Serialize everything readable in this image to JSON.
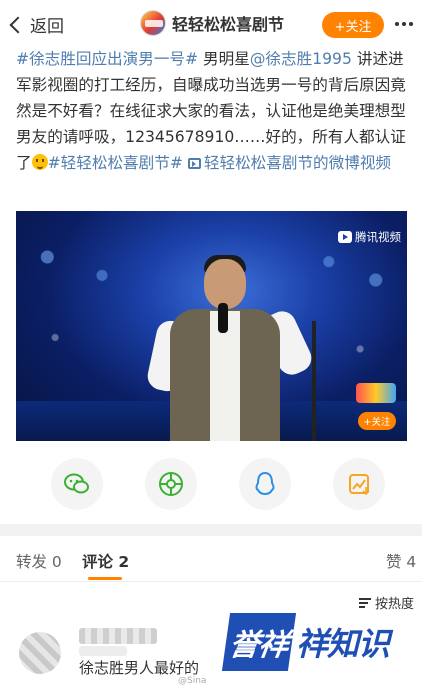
{
  "topbar": {
    "back_label": "返回",
    "account_name": "轻轻松松喜剧节",
    "follow_label": "+关注"
  },
  "post": {
    "seg1": "#徐志胜回应出演男一号#",
    "seg2": " 男明星",
    "seg3": "@徐志胜1995",
    "seg4": " 讲述进军影视圈的打工经历，自曝成功当选男一号的背后原因竟然是不好看？在线征求大家的看法，认证他是绝美理想型男友的请呼吸，12345678910……好的，所有人都认证了",
    "seg5": "#轻轻松松喜剧节#",
    "seg6": "轻轻松松喜剧节的微博视频"
  },
  "video": {
    "watermark": "腾讯视频",
    "follow_label": "+关注"
  },
  "share_icons": [
    "wechat-icon",
    "moments-icon",
    "qq-icon",
    "qzone-icon"
  ],
  "tabs": {
    "repost": "转发 0",
    "comment": "评论 2",
    "like": "赞 4"
  },
  "sort_label": "按热度",
  "comment": {
    "text": "徐志胜男人最好的"
  },
  "watermark": {
    "badge": "誉祥",
    "text": "祥知识",
    "corner": "@Sina"
  },
  "colors": {
    "accent": "#ff8200",
    "link": "#507daf",
    "brand_blue": "#1f4fb5"
  }
}
